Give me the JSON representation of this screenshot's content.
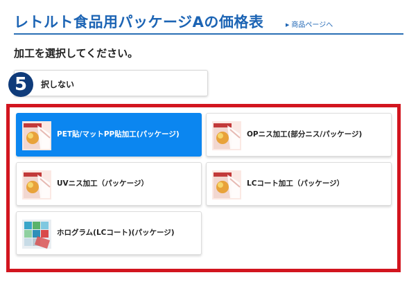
{
  "header": {
    "title": "レトルト食品用パッケージAの価格表",
    "product_link": "商品ページへ"
  },
  "prompt": "加工を選択してください。",
  "step_badge": "5",
  "no_processing": {
    "label": "選択しない",
    "visible_label": "択しない"
  },
  "options": [
    {
      "label": "PET貼/マットPP貼加工(パッケージ)",
      "selected": true,
      "icon": "pouch-thumbnail"
    },
    {
      "label": "OPニス加工(部分ニス/パッケージ)",
      "selected": false,
      "icon": "pouch-thumbnail"
    },
    {
      "label": "UVニス加工（パッケージ）",
      "selected": false,
      "icon": "pouch-thumbnail"
    },
    {
      "label": "LCコート加工（パッケージ）",
      "selected": false,
      "icon": "pouch-thumbnail"
    },
    {
      "label": "ホログラム(LCコート)(パッケージ)",
      "selected": false,
      "icon": "hologram-thumbnail"
    }
  ],
  "colors": {
    "title": "#1c64b4",
    "selected": "#0b86f0",
    "frame": "#d2151f",
    "badge": "#0f3b7a"
  }
}
